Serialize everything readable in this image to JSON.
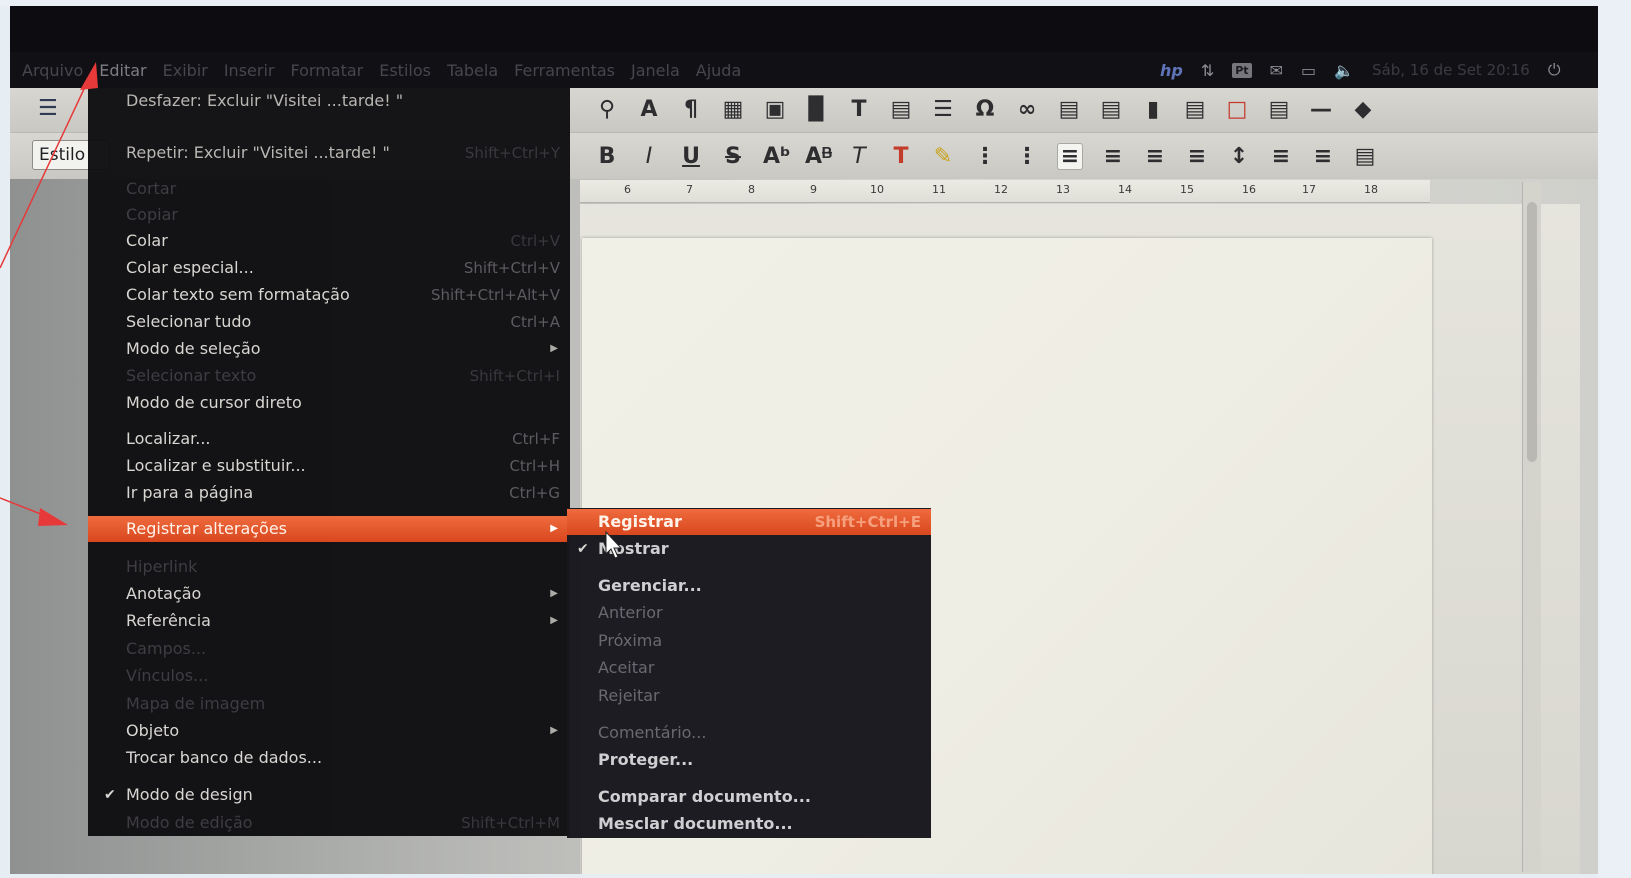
{
  "menubar": {
    "items": [
      "Arquivo",
      "Editar",
      "Exibir",
      "Inserir",
      "Formatar",
      "Estilos",
      "Tabela",
      "Ferramentas",
      "Janela",
      "Ajuda"
    ]
  },
  "tray": {
    "hp": "hp",
    "keyboard": "Pt",
    "clock": "Sáb, 16 de Set 20:16"
  },
  "toolbar": {
    "style_box": "Estilo",
    "formatting_icons": [
      "B",
      "I",
      "U",
      "S"
    ]
  },
  "ruler": {
    "ticks": [
      "6",
      "7",
      "8",
      "9",
      "10",
      "11",
      "12",
      "13",
      "14",
      "15",
      "16",
      "17",
      "18"
    ]
  },
  "edit_menu": {
    "items": [
      {
        "label": "Desfazer: Excluir \"Visitei ...tarde! \"",
        "shortcut": "",
        "state": "mid"
      },
      {
        "label": "Repetir: Excluir \"Visitei ...tarde! \"",
        "shortcut": "Shift+Ctrl+Y",
        "state": "mid"
      },
      {
        "label": "Cortar",
        "shortcut": "",
        "state": "disabled"
      },
      {
        "label": "Copiar",
        "shortcut": "",
        "state": "disabled"
      },
      {
        "label": "Colar",
        "shortcut": "Ctrl+V",
        "state": "normal"
      },
      {
        "label": "Colar especial...",
        "shortcut": "Shift+Ctrl+V",
        "state": "normal"
      },
      {
        "label": "Colar texto sem formatação",
        "shortcut": "Shift+Ctrl+Alt+V",
        "state": "normal"
      },
      {
        "label": "Selecionar tudo",
        "shortcut": "Ctrl+A",
        "state": "normal"
      },
      {
        "label": "Modo de seleção",
        "shortcut": "",
        "state": "submenu"
      },
      {
        "label": "Selecionar texto",
        "shortcut": "Shift+Ctrl+I",
        "state": "disabled"
      },
      {
        "label": "Modo de cursor direto",
        "shortcut": "",
        "state": "normal"
      },
      {
        "label": "Localizar...",
        "shortcut": "Ctrl+F",
        "state": "normal"
      },
      {
        "label": "Localizar e substituir...",
        "shortcut": "Ctrl+H",
        "state": "normal"
      },
      {
        "label": "Ir para a página",
        "shortcut": "Ctrl+G",
        "state": "normal"
      },
      {
        "label": "Registrar alterações",
        "shortcut": "",
        "state": "highlighted"
      },
      {
        "label": "Hiperlink",
        "shortcut": "",
        "state": "disabled"
      },
      {
        "label": "Anotação",
        "shortcut": "",
        "state": "submenu"
      },
      {
        "label": "Referência",
        "shortcut": "",
        "state": "submenu"
      },
      {
        "label": "Campos...",
        "shortcut": "",
        "state": "disabled"
      },
      {
        "label": "Vínculos...",
        "shortcut": "",
        "state": "disabled"
      },
      {
        "label": "Mapa de imagem",
        "shortcut": "",
        "state": "disabled"
      },
      {
        "label": "Objeto",
        "shortcut": "",
        "state": "submenu"
      },
      {
        "label": "Trocar banco de dados...",
        "shortcut": "",
        "state": "normal"
      },
      {
        "label": "Modo de design",
        "shortcut": "",
        "state": "checked"
      },
      {
        "label": "Modo de edição",
        "shortcut": "Shift+Ctrl+M",
        "state": "disabled"
      }
    ]
  },
  "track_changes_menu": {
    "items": [
      {
        "label": "Registrar",
        "shortcut": "Shift+Ctrl+E",
        "state": "highlighted"
      },
      {
        "label": "Mostrar",
        "shortcut": "",
        "state": "checked"
      },
      {
        "label": "Gerenciar...",
        "shortcut": "",
        "state": "normal"
      },
      {
        "label": "Anterior",
        "shortcut": "",
        "state": "disabled"
      },
      {
        "label": "Próxima",
        "shortcut": "",
        "state": "disabled"
      },
      {
        "label": "Aceitar",
        "shortcut": "",
        "state": "disabled"
      },
      {
        "label": "Rejeitar",
        "shortcut": "",
        "state": "disabled"
      },
      {
        "label": "Comentário...",
        "shortcut": "",
        "state": "disabled"
      },
      {
        "label": "Proteger...",
        "shortcut": "",
        "state": "normal"
      },
      {
        "label": "Comparar documento...",
        "shortcut": "",
        "state": "normal"
      },
      {
        "label": "Mesclar documento...",
        "shortcut": "",
        "state": "normal"
      }
    ]
  },
  "colors": {
    "highlight": "#e4562a",
    "annotation_arrow": "#e8393a",
    "menu_bg": "#0e0d11"
  }
}
